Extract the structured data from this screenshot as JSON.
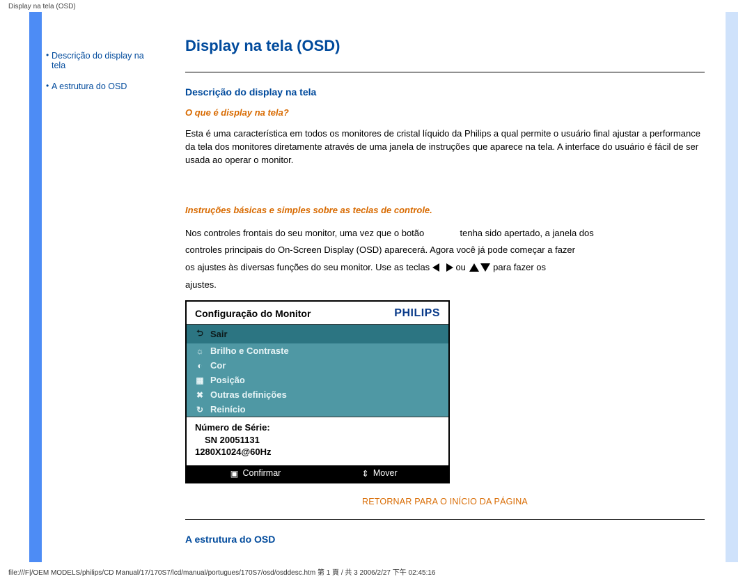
{
  "header_label": "Display na tela (OSD)",
  "sidebar": {
    "items": [
      {
        "label": "Descrição do display na tela",
        "dot": true
      },
      {
        "label": "A estrutura do OSD",
        "dot": true
      }
    ]
  },
  "page": {
    "title": "Display na tela (OSD)",
    "section1": {
      "heading": "Descrição do display na tela",
      "sub1": "O que é display na tela?",
      "para1": "Esta é uma característica em todos os monitores de cristal líquido da Philips a qual permite o usuário final ajustar a performance da tela dos monitores diretamente através de uma janela de instruções que aparece na tela. A interface do usuário é fácil de ser usada ao operar o monitor.",
      "sub2": "Instruções básicas e simples sobre as teclas de controle.",
      "p2a": "Nos controles frontais do seu monitor,  uma vez que o botão",
      "p2b": "tenha sido apertado, a janela dos",
      "p2c": "controles principais do On-Screen Display (OSD) aparecerá. Agora você já pode começar a fazer",
      "p2d": "os ajustes às diversas funções do seu monitor. Use as teclas",
      "p2e": "ou",
      "p2f": "para fazer os",
      "p2g": "ajustes."
    },
    "osd": {
      "title": "Configuração do Monitor",
      "brand": "PHILIPS",
      "items": [
        "Sair",
        "Brilho e Contraste",
        "Cor",
        "Posição",
        "Outras definições",
        "Reinício"
      ],
      "serial_label": "Número de Série:",
      "serial_value": "SN 20051131",
      "mode": "1280X1024@60Hz",
      "confirm": "Confirmar",
      "move": "Mover"
    },
    "back_top": "RETORNAR PARA O INÍCIO DA PÁGINA",
    "section2": {
      "heading": "A estrutura do OSD"
    }
  },
  "footer_path": "file:///F|/OEM MODELS/philips/CD Manual/17/170S7/lcd/manual/portugues/170S7/osd/osddesc.htm 第 1 頁 / 共 3 2006/2/27 下午 02:45:16"
}
